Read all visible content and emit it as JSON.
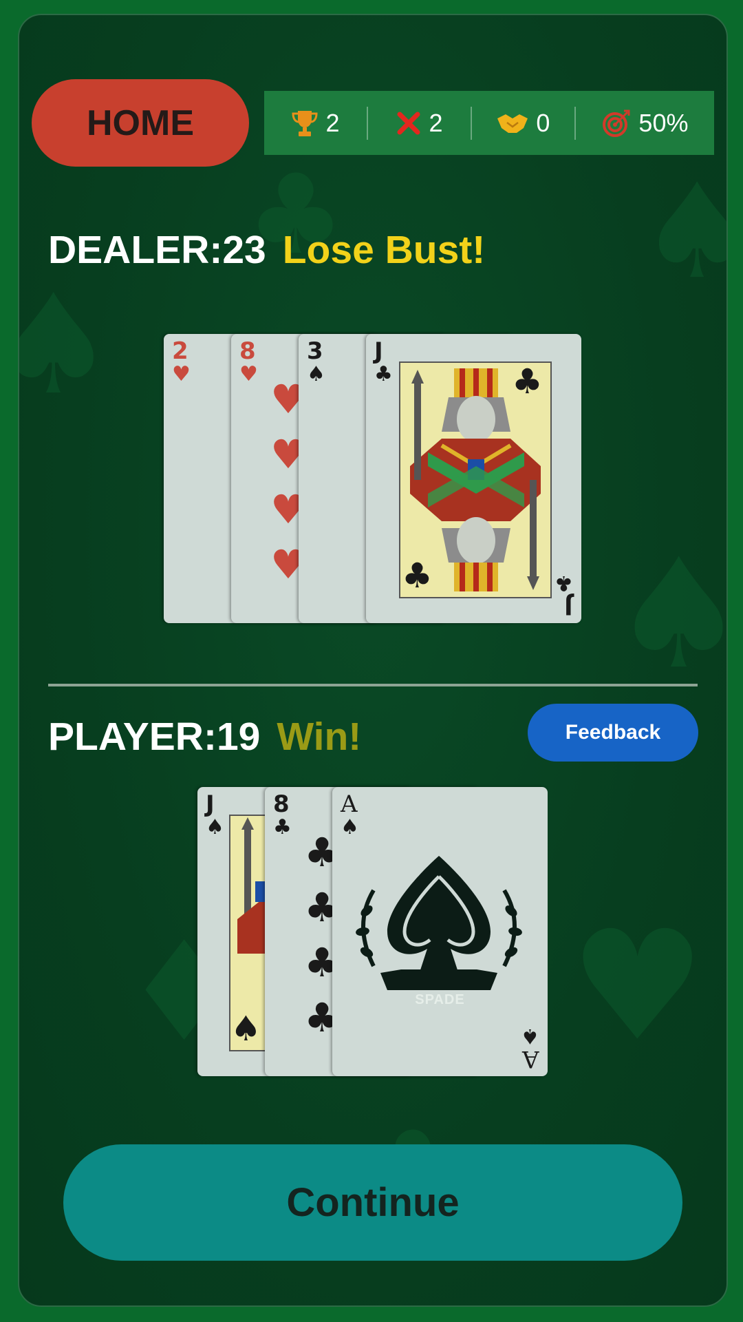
{
  "nav": {
    "home_label": "HOME"
  },
  "stats": {
    "wins": "2",
    "losses": "2",
    "draws": "0",
    "win_rate": "50%",
    "icons": [
      "trophy-icon",
      "x-icon",
      "handshake-icon",
      "target-icon"
    ]
  },
  "dealer": {
    "label": "DEALER:23",
    "result": "Lose Bust!",
    "cards": [
      {
        "rank": "2",
        "suit": "♥",
        "color": "red"
      },
      {
        "rank": "8",
        "suit": "♥",
        "color": "red"
      },
      {
        "rank": "3",
        "suit": "♠",
        "color": "black"
      },
      {
        "rank": "J",
        "suit": "♣",
        "color": "black"
      }
    ]
  },
  "player": {
    "label": "PLAYER:19",
    "result": "Win!",
    "cards": [
      {
        "rank": "J",
        "suit": "♠",
        "color": "black"
      },
      {
        "rank": "8",
        "suit": "♣",
        "color": "black"
      },
      {
        "rank": "A",
        "suit": "♠",
        "color": "black"
      }
    ],
    "ace_banner": "SPADE"
  },
  "buttons": {
    "feedback": "Feedback",
    "continue": "Continue"
  },
  "colors": {
    "table": "#073e1f",
    "home": "#c8402e",
    "stats_bar": "#1d7c3e",
    "dealer_result": "#f2d21a",
    "player_result": "#9a9b16",
    "feedback": "#1764c6",
    "continue": "#0c8b86"
  }
}
